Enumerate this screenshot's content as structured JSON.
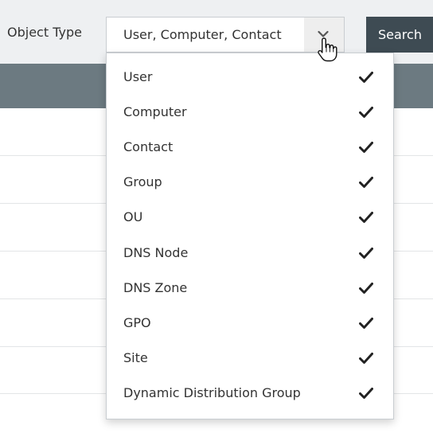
{
  "filter": {
    "label": "Object Type",
    "selected_value": "User, Computer, Contact"
  },
  "search": {
    "label": "Search"
  },
  "dropdown": {
    "options": [
      {
        "label": "User",
        "checked": true
      },
      {
        "label": "Computer",
        "checked": true
      },
      {
        "label": "Contact",
        "checked": true
      },
      {
        "label": "Group",
        "checked": true
      },
      {
        "label": "OU",
        "checked": true
      },
      {
        "label": "DNS Node",
        "checked": true
      },
      {
        "label": "DNS Zone",
        "checked": true
      },
      {
        "label": "GPO",
        "checked": true
      },
      {
        "label": "Site",
        "checked": true
      },
      {
        "label": "Dynamic Distribution Group",
        "checked": true
      }
    ]
  },
  "icons": {
    "arrow": "chevron-down-icon",
    "cursor": "hand-pointer-icon",
    "check": "checkmark-icon"
  },
  "colors": {
    "toolbar_bg": "#eef0f2",
    "search_button_bg": "#3e4b53",
    "table_header_bg": "#6c7a81",
    "check_color": "#222222"
  }
}
